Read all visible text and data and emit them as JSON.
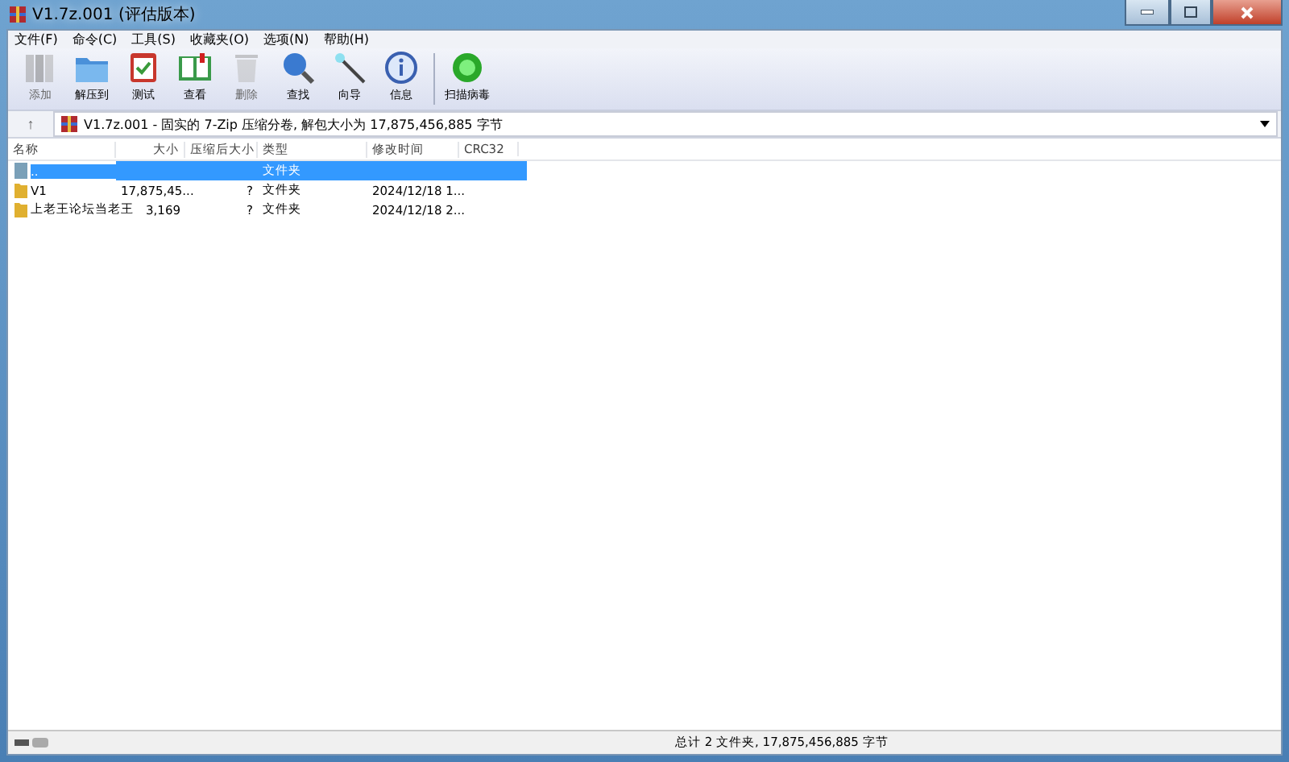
{
  "window": {
    "title": "V1.7z.001 (评估版本)"
  },
  "menu": [
    "文件(F)",
    "命令(C)",
    "工具(S)",
    "收藏夹(O)",
    "选项(N)",
    "帮助(H)"
  ],
  "toolbar": [
    {
      "kind": "add",
      "label": "添加",
      "disabled": true
    },
    {
      "kind": "extract",
      "label": "解压到",
      "disabled": false
    },
    {
      "kind": "test",
      "label": "测试",
      "disabled": false
    },
    {
      "kind": "view",
      "label": "查看",
      "disabled": false
    },
    {
      "kind": "delete",
      "label": "删除",
      "disabled": true
    },
    {
      "kind": "find",
      "label": "查找",
      "disabled": false
    },
    {
      "kind": "wizard",
      "label": "向导",
      "disabled": false
    },
    {
      "kind": "info",
      "label": "信息",
      "disabled": false
    },
    {
      "kind": "virus",
      "label": "扫描病毒",
      "disabled": false
    }
  ],
  "address": {
    "up": "↑",
    "path": "V1.7z.001 - 固实的 7-Zip 压缩分卷, 解包大小为 17,875,456,885 字节"
  },
  "table": {
    "columns": [
      "名称",
      "大小",
      "压缩后大小",
      "类型",
      "修改时间",
      "CRC32"
    ],
    "rows": [
      {
        "kind": "parent",
        "name": "..",
        "size": "",
        "packed": "",
        "type": "文件夹",
        "modified": "",
        "selected": true
      },
      {
        "kind": "folder",
        "name": "V1",
        "size": "17,875,45...",
        "packed": "?",
        "type": "文件夹",
        "modified": "2024/12/18 1...",
        "selected": false
      },
      {
        "kind": "folder",
        "name": "上老王论坛当老王",
        "size": "3,169",
        "packed": "?",
        "type": "文件夹",
        "modified": "2024/12/18 2...",
        "selected": false
      }
    ]
  },
  "status_bar": {
    "summary": "总计 2 文件夹, 17,875,456,885 字节"
  }
}
